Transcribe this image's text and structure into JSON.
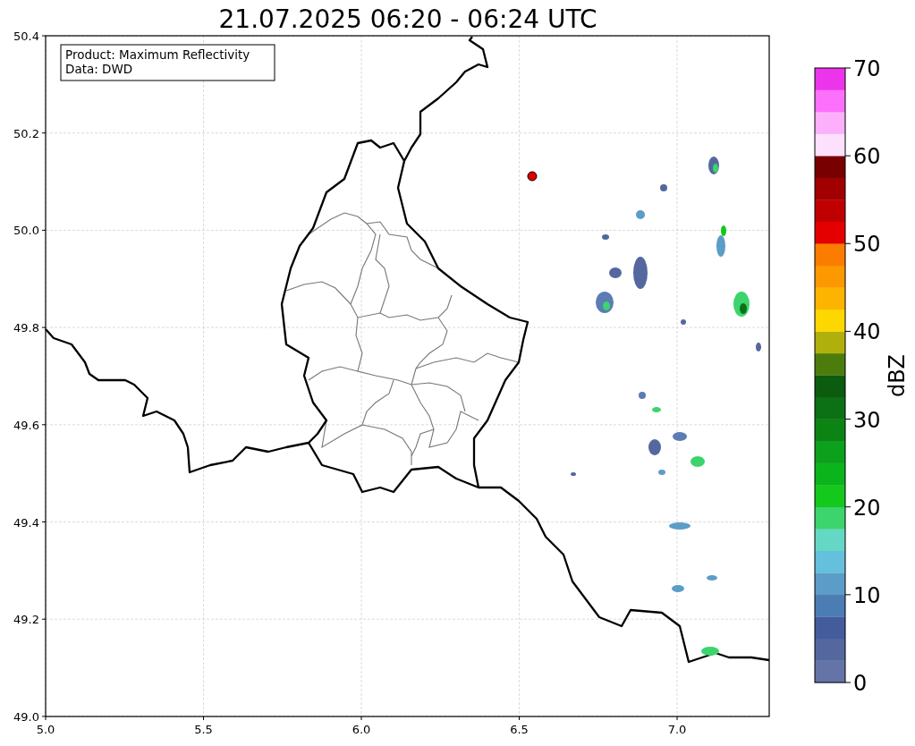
{
  "title": "21.07.2025 06:20 - 06:24 UTC",
  "info_box": [
    "Product: Maximum Reflectivity",
    "Data: DWD"
  ],
  "x_ticks": [
    "5.0",
    "5.5",
    "6.0",
    "6.5",
    "7.0"
  ],
  "y_ticks": [
    "50.4",
    "50.2",
    "50.0",
    "49.8",
    "49.6",
    "49.4",
    "49.2",
    "49.0"
  ],
  "colorbar": {
    "label": "dBZ",
    "ticks": [
      "70",
      "60",
      "50",
      "40",
      "30",
      "20",
      "10",
      "0"
    ],
    "segments": [
      {
        "color": "#6474a8"
      },
      {
        "color": "#54689f"
      },
      {
        "color": "#445c9c"
      },
      {
        "color": "#4c7cb4"
      },
      {
        "color": "#5c9cc8"
      },
      {
        "color": "#64c0dc"
      },
      {
        "color": "#64d8c4"
      },
      {
        "color": "#3cd46c"
      },
      {
        "color": "#14c81c"
      },
      {
        "color": "#0cb41c"
      },
      {
        "color": "#0ca01c"
      },
      {
        "color": "#0c8414"
      },
      {
        "color": "#0c7014"
      },
      {
        "color": "#0c5c10"
      },
      {
        "color": "#4c7c0c"
      },
      {
        "color": "#b0b00c"
      },
      {
        "color": "#fcd800"
      },
      {
        "color": "#fcb400"
      },
      {
        "color": "#fc9800"
      },
      {
        "color": "#fc7c00"
      },
      {
        "color": "#e40000"
      },
      {
        "color": "#c00000"
      },
      {
        "color": "#a00000"
      },
      {
        "color": "#780000"
      },
      {
        "color": "#fce0fc"
      },
      {
        "color": "#fcb0fc"
      },
      {
        "color": "#fc70fc"
      },
      {
        "color": "#ec34ec"
      }
    ]
  }
}
